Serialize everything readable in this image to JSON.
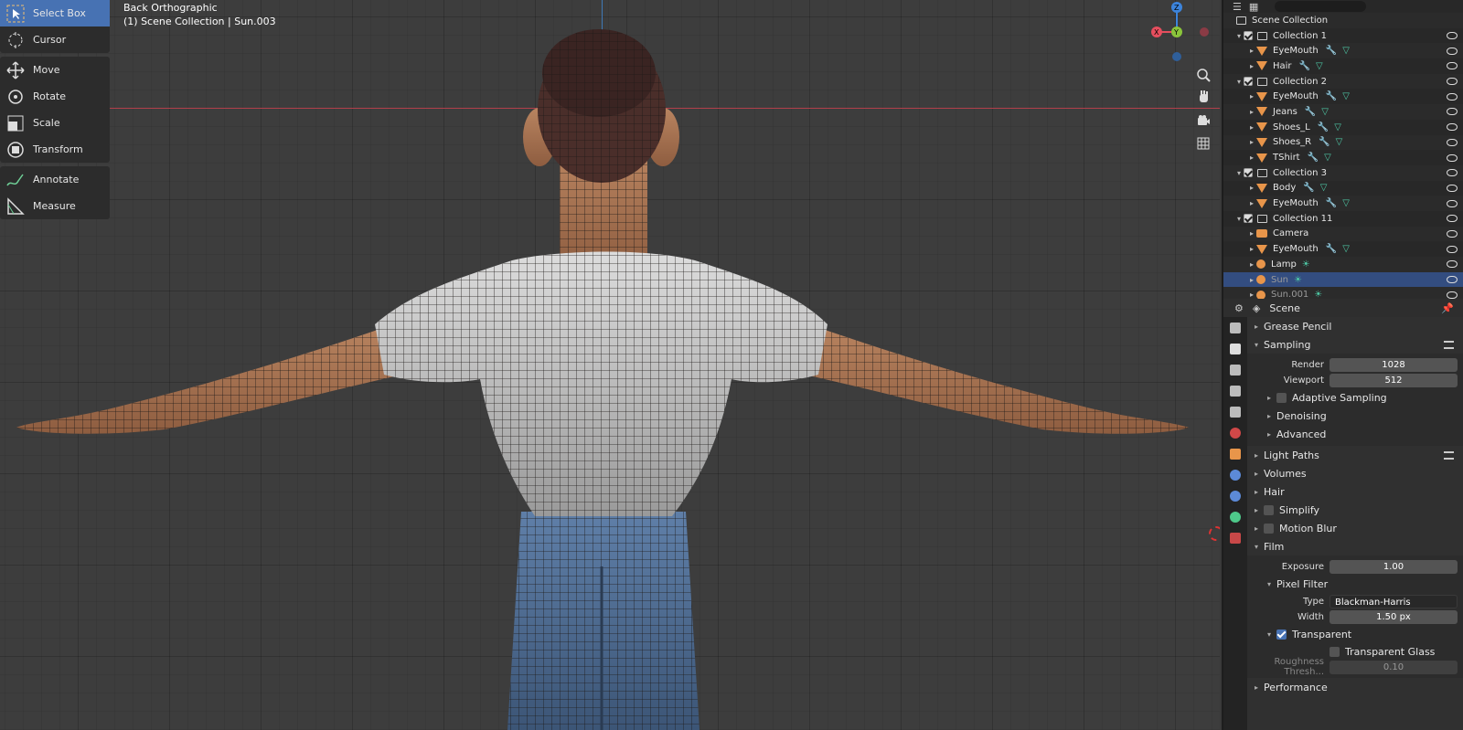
{
  "viewport": {
    "view_name": "Back Orthographic",
    "context": "(1) Scene Collection | Sun.003"
  },
  "tools": [
    {
      "label": "Select Box",
      "icon": "select-box-icon",
      "active": true
    },
    {
      "label": "Cursor",
      "icon": "cursor-icon"
    },
    {
      "label": "Move",
      "icon": "move-icon"
    },
    {
      "label": "Rotate",
      "icon": "rotate-icon"
    },
    {
      "label": "Scale",
      "icon": "scale-icon"
    },
    {
      "label": "Transform",
      "icon": "transform-icon"
    },
    {
      "label": "Annotate",
      "icon": "annotate-icon"
    },
    {
      "label": "Measure",
      "icon": "measure-icon"
    }
  ],
  "gizmo": {
    "x": "X",
    "y": "Y",
    "z": "Z",
    "colors": {
      "x": "#e64e5e",
      "y": "#8ac53b",
      "z": "#3c84dc"
    }
  },
  "outliner": {
    "root": "Scene Collection",
    "rows": [
      {
        "label": "Collection 1",
        "type": "collection"
      },
      {
        "label": "EyeMouth",
        "type": "mesh"
      },
      {
        "label": "Hair",
        "type": "mesh"
      },
      {
        "label": "Collection 2",
        "type": "collection"
      },
      {
        "label": "EyeMouth",
        "type": "mesh"
      },
      {
        "label": "Jeans",
        "type": "mesh"
      },
      {
        "label": "Shoes_L",
        "type": "mesh"
      },
      {
        "label": "Shoes_R",
        "type": "mesh"
      },
      {
        "label": "TShirt",
        "type": "mesh"
      },
      {
        "label": "Collection 3",
        "type": "collection"
      },
      {
        "label": "Body",
        "type": "mesh"
      },
      {
        "label": "EyeMouth",
        "type": "mesh"
      },
      {
        "label": "Collection 11",
        "type": "collection"
      },
      {
        "label": "Camera",
        "type": "camera"
      },
      {
        "label": "EyeMouth",
        "type": "mesh"
      },
      {
        "label": "Lamp",
        "type": "lamp"
      },
      {
        "label": "Sun",
        "type": "lamp",
        "selected": true
      },
      {
        "label": "Sun.001",
        "type": "lamp"
      }
    ]
  },
  "properties": {
    "context": "Scene",
    "sections": {
      "grease_pencil": "Grease Pencil",
      "sampling": "Sampling",
      "render_label": "Render",
      "render_value": "1028",
      "viewport_label": "Viewport",
      "viewport_value": "512",
      "adaptive": "Adaptive Sampling",
      "denoising": "Denoising",
      "advanced": "Advanced",
      "light_paths": "Light Paths",
      "volumes": "Volumes",
      "hair": "Hair",
      "simplify": "Simplify",
      "motion_blur": "Motion Blur",
      "film": "Film",
      "exposure_label": "Exposure",
      "exposure_value": "1.00",
      "pixel_filter": "Pixel Filter",
      "type_label": "Type",
      "type_value": "Blackman-Harris",
      "width_label": "Width",
      "width_value": "1.50 px",
      "transparent": "Transparent",
      "transparent_glass": "Transparent Glass",
      "roughness_label": "Roughness Thresh...",
      "roughness_value": "0.10",
      "performance": "Performance"
    }
  }
}
